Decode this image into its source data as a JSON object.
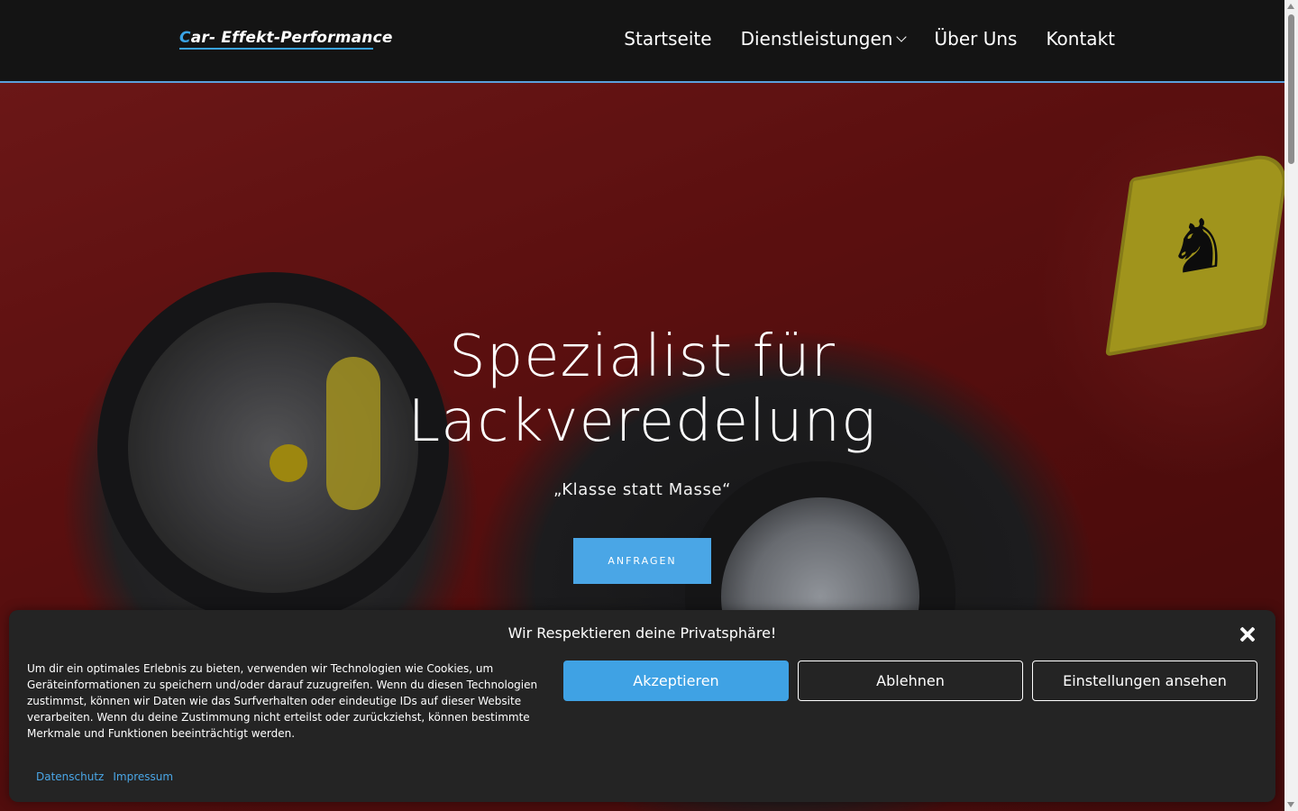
{
  "header": {
    "logo_first": "C",
    "logo_rest": "ar- Effekt-Performance",
    "nav": [
      {
        "label": "Startseite"
      },
      {
        "label": "Dienstleistungen"
      },
      {
        "label": "Über Uns"
      },
      {
        "label": "Kontakt"
      }
    ]
  },
  "hero": {
    "title_line1": "Spezialist für",
    "title_line2": "Lackveredelung",
    "subtitle": "„Klasse statt Masse“",
    "cta_label": "ANFRAGEN"
  },
  "cookie": {
    "title": "Wir Respektieren deine Privatsphäre!",
    "text": "Um dir ein optimales Erlebnis zu bieten, verwenden wir Technologien wie Cookies, um Geräteinformationen zu speichern und/oder darauf zuzugreifen. Wenn du diesen Technologien zustimmst, können wir Daten wie das Surfverhalten oder eindeutige IDs auf dieser Website verarbeiten. Wenn du deine Zustimmung nicht erteilst oder zurückziehst, können bestimmte Merkmale und Funktionen beeinträchtigt werden.",
    "accept_label": "Akzeptieren",
    "deny_label": "Ablehnen",
    "settings_label": "Einstellungen ansehen",
    "links": [
      "Datenschutz",
      "Impressum"
    ]
  },
  "colors": {
    "accent": "#4aa6e6",
    "header_bg": "#141414",
    "banner_bg": "#242424"
  }
}
